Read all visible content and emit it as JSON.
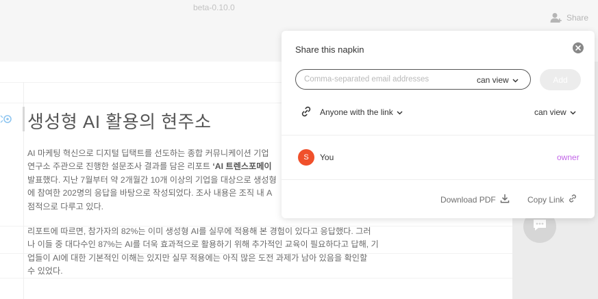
{
  "app": {
    "version": "beta-0.10.0",
    "share_label": "Share"
  },
  "document": {
    "title": "생성형 AI 활용의 현주소",
    "paragraph1": {
      "line1": "AI 마케팅 혁신으로 디지털 딥택트를 선도하는 종합 커뮤니케이션 기업",
      "line2_before": "연구소 주관으로 진행한 설문조사 결과를 담은 리포트 ",
      "line2_bold": "‘AI 트렌스포메이",
      "line3": "발표했다. 지난 7월부터 약 2개월간 10개 이상의 기업을 대상으로 생성형",
      "line4": "에 참여한 202명의 응답을 바탕으로 작성되었다. 조사 내용은 조직 내 A",
      "line5": "점적으로 다루고 있다."
    },
    "paragraph2": {
      "line1": "리포트에 따르면, 참가자의 82%는 이미 생성형 AI를 실무에 적용해 본 경험이 있다고 응답했다. 그러",
      "line2": "나 이들 중 대다수인 87%는 AI를 더욱 효과적으로 활용하기 위해 추가적인 교육이 필요하다고 답해, 기",
      "line3": "업들이 AI에 대한 기본적인 이해는 있지만 실무 적용에는 아직 많은 도전 과제가 남아 있음을 확인할",
      "line4": "수 있었다."
    }
  },
  "share_dialog": {
    "title": "Share this napkin",
    "email_placeholder": "Comma-separated email addresses",
    "email_value": "",
    "invite_permission": "can view",
    "add_label": "Add",
    "link_access_label": "Anyone with the link",
    "link_permission": "can view",
    "members": [
      {
        "initial": "S",
        "name": "You",
        "role": "owner"
      }
    ],
    "download_pdf_label": "Download PDF",
    "copy_link_label": "Copy Link"
  },
  "colors": {
    "accent_owner": "#c266e8",
    "avatar_bg": "#f0502b",
    "add_button_bg": "#ececec"
  }
}
